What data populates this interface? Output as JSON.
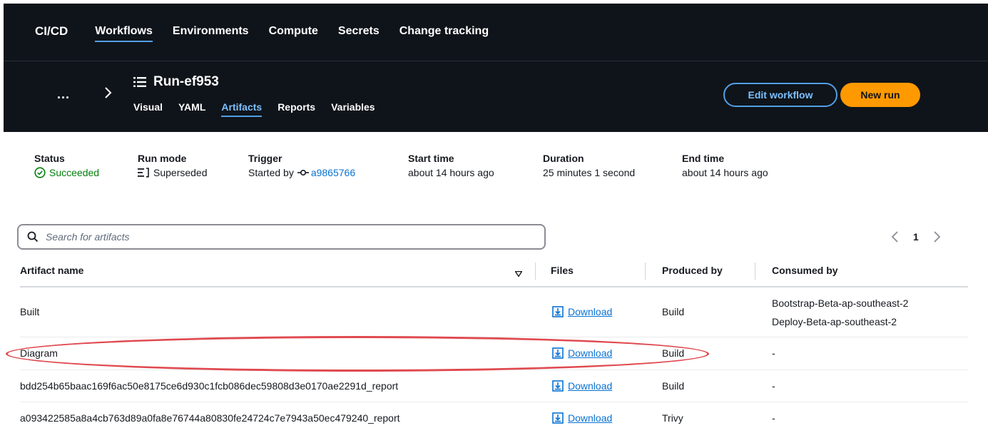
{
  "topnav": {
    "brand": "CI/CD",
    "items": [
      "Workflows",
      "Environments",
      "Compute",
      "Secrets",
      "Change tracking"
    ]
  },
  "run": {
    "ellipsis": "...",
    "title": "Run-ef953",
    "tabs": [
      "Visual",
      "YAML",
      "Artifacts",
      "Reports",
      "Variables"
    ],
    "edit_label": "Edit workflow",
    "new_label": "New run"
  },
  "summary": {
    "status_label": "Status",
    "status_value": "Succeeded",
    "runmode_label": "Run mode",
    "runmode_value": "Superseded",
    "trigger_label": "Trigger",
    "trigger_prefix": "Started by",
    "trigger_commit": "a9865766",
    "start_label": "Start time",
    "start_value": "about 14 hours ago",
    "duration_label": "Duration",
    "duration_value": "25 minutes 1 second",
    "end_label": "End time",
    "end_value": "about 14 hours ago"
  },
  "search": {
    "placeholder": "Search for artifacts"
  },
  "pager": {
    "page": "1"
  },
  "table": {
    "headers": {
      "name": "Artifact name",
      "files": "Files",
      "produced": "Produced by",
      "consumed": "Consumed by"
    },
    "rows": [
      {
        "name": "Built",
        "files": "Download",
        "produced": "Build",
        "consumed": [
          "Bootstrap-Beta-ap-southeast-2",
          "Deploy-Beta-ap-southeast-2"
        ]
      },
      {
        "name": "Diagram",
        "files": "Download",
        "produced": "Build",
        "consumed": [
          "-"
        ]
      },
      {
        "name": "bdd254b65baac169f6ac50e8175ce6d930c1fcb086dec59808d3e0170ae2291d_report",
        "files": "Download",
        "produced": "Build",
        "consumed": [
          "-"
        ]
      },
      {
        "name": "a093422585a8a4cb763d89a0fa8e76744a80830fe24724c7e7943a50ec479240_report",
        "files": "Download",
        "produced": "Trivy",
        "consumed": [
          "-"
        ]
      }
    ]
  },
  "colors": {
    "accent": "#539fe5",
    "primary_button": "#ff9900",
    "success": "#037f0c",
    "highlight": "#e0494f",
    "link": "#0972d3"
  }
}
